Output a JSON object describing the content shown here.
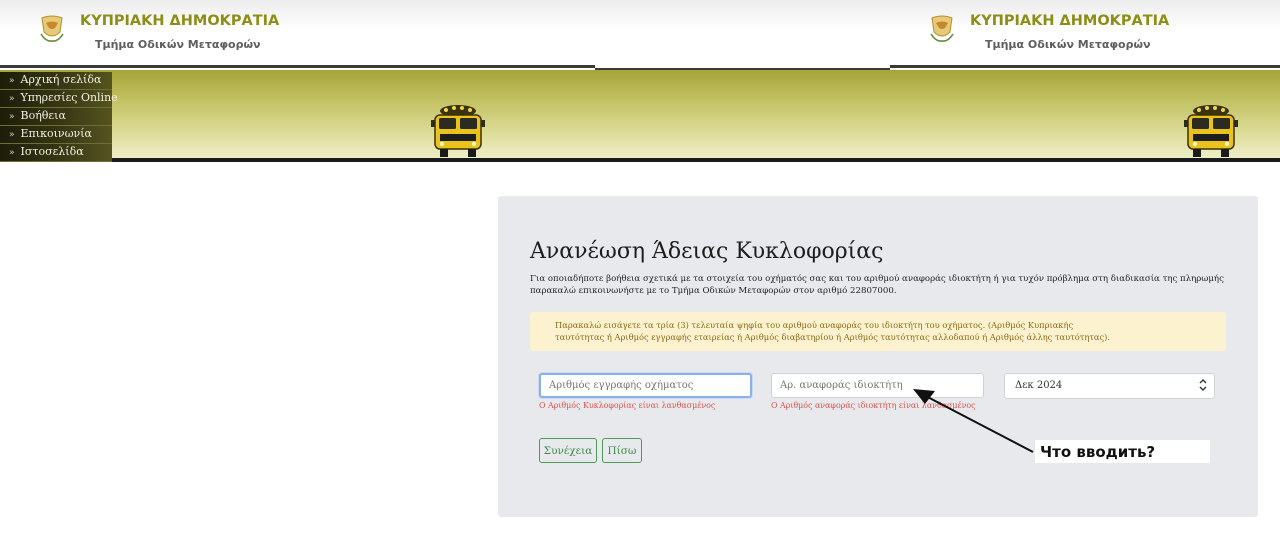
{
  "header": {
    "title": "ΚΥΠΡΙΑΚΗ ΔΗΜΟΚΡΑΤΙΑ",
    "subtitle": "Τμήμα Οδικών Μεταφορών"
  },
  "nav": {
    "items": [
      {
        "label": "Αρχική σελίδα"
      },
      {
        "label": "Υπηρεσίες Online"
      },
      {
        "label": "Βοήθεια"
      },
      {
        "label": "Επικοινωνία"
      },
      {
        "label": "Ιστοσελίδα"
      }
    ]
  },
  "form": {
    "title": "Ανανέωση Άδειας Κυκλοφορίας",
    "intro": "Για οποιαδήποτε βοήθεια σχετικά με τα στοιχεία του οχήματός σας και του αριθμού αναφοράς ιδιοκτήτη ή για τυχόν πρόβλημα στη διαδικασία της πληρωμής παρακαλώ επικοινωνήστε με το Τμήμα Οδικών Μεταφορών στον αριθμό 22807000.",
    "alert": "Παρακαλώ εισάγετε τα τρία (3) τελευταία ψηφία του αριθμού αναφοράς του ιδιοκτήτη του οχήματος. (Αριθμός Κυπριακής ταυτότητας ή Αριθμός εγγραφής εταιρείας ή Αριθμός διαβατηρίου ή Αριθμός ταυτότητας αλλοδαπού ή Αριθμός άλλης ταυτότητας).",
    "registration": {
      "value": "",
      "placeholder": "Αριθμός εγγραφής οχήματος",
      "error": "Ο Αριθμός Κυκλοφορίας είναι λανθασμένος"
    },
    "owner_ref": {
      "value": "",
      "placeholder": "Αρ. αναφοράς ιδιοκτήτη",
      "error": "Ο Αριθμός αναφοράς ιδιοκτήτη είναι λανθασμένος"
    },
    "period": {
      "selected": "Δεκ 2024"
    },
    "buttons": {
      "continue": "Συνέχεια",
      "back": "Πίσω"
    }
  },
  "annotation": {
    "text": "Что вводить?"
  },
  "colors": {
    "brand_title": "#8c8f16",
    "error": "#d9534f",
    "button_green": "#3c8b47",
    "alert_bg": "#fdf2cf",
    "card_bg": "#e8e9ec"
  },
  "icons": {
    "emblem": "cyprus-coat-of-arms-icon",
    "bus": "school-bus-icon",
    "nav_bullet": "double-chevron-icon",
    "select_caret": "chevron-updown-icon"
  }
}
